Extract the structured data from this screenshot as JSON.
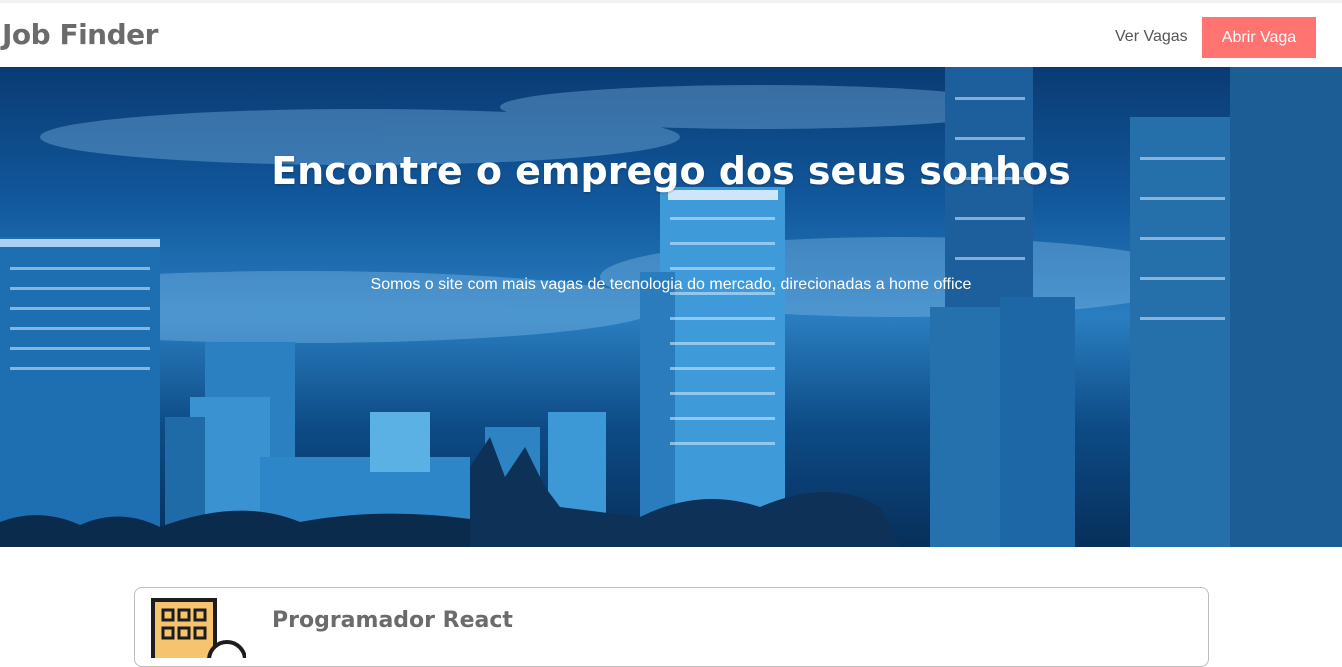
{
  "navbar": {
    "brand": "Job Finder",
    "links": [
      {
        "label": "Ver Vagas"
      }
    ],
    "cta_label": "Abrir Vaga",
    "cta_color": "#ff7470"
  },
  "hero": {
    "title": "Encontre o emprego dos seus sonhos",
    "subtitle": "Somos o site com mais vagas de tecnologia do mercado, direcionadas a home office",
    "background_image": "city-skyline-night-blue"
  },
  "jobs": [
    {
      "title": "Programador React",
      "icon": "building-icon"
    }
  ],
  "colors": {
    "brand_text": "#6b6b6b",
    "accent": "#ff7470",
    "card_border": "#bdbdbd"
  }
}
